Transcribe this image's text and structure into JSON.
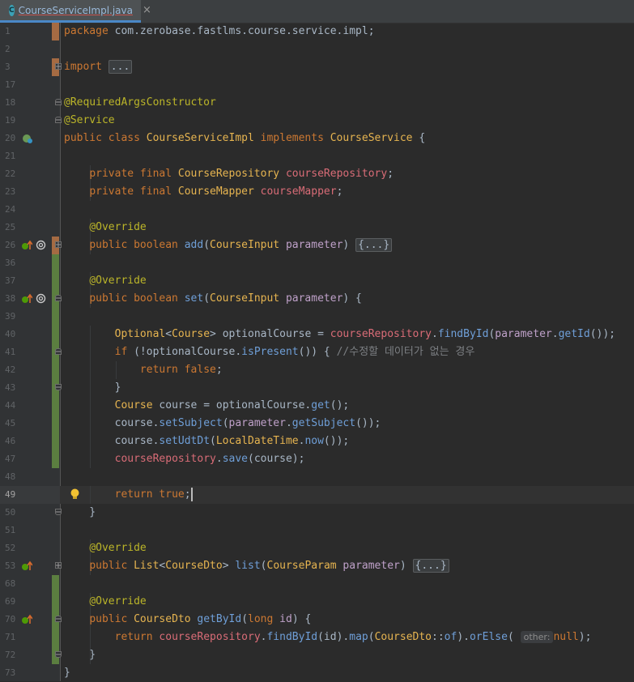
{
  "tab": {
    "filename": "CourseServiceImpl.java",
    "close_glyph": "×",
    "icon_letter": "C",
    "icon": "java-class-icon"
  },
  "lines": [
    {
      "n": "1",
      "vcs": "mod",
      "tokens": [
        [
          "kw",
          "package "
        ],
        [
          "plain",
          "com.zerobase.fastlms.course.service.impl;"
        ]
      ]
    },
    {
      "n": "2"
    },
    {
      "n": "3",
      "vcs": "mod",
      "fold": "plus",
      "tokens": [
        [
          "kw",
          "import "
        ],
        [
          "folded",
          "..."
        ]
      ]
    },
    {
      "n": "17"
    },
    {
      "n": "18",
      "fold": "start",
      "tokens": [
        [
          "ann",
          "@RequiredArgsConstructor"
        ]
      ]
    },
    {
      "n": "19",
      "fold": "start",
      "tokens": [
        [
          "ann",
          "@Service"
        ]
      ]
    },
    {
      "n": "20",
      "gicon": "bean",
      "tokens": [
        [
          "kw",
          "public class "
        ],
        [
          "cls",
          "CourseServiceImpl "
        ],
        [
          "kw",
          "implements "
        ],
        [
          "cls",
          "CourseService "
        ],
        [
          "plain",
          "{"
        ]
      ]
    },
    {
      "n": "21"
    },
    {
      "n": "22",
      "tokens": [
        [
          "plain",
          "    "
        ],
        [
          "kw",
          "private final "
        ],
        [
          "cls",
          "CourseRepository "
        ],
        [
          "fld",
          "courseRepository"
        ],
        [
          "plain",
          ";"
        ]
      ]
    },
    {
      "n": "23",
      "tokens": [
        [
          "plain",
          "    "
        ],
        [
          "kw",
          "private final "
        ],
        [
          "cls",
          "CourseMapper "
        ],
        [
          "fld",
          "courseMapper"
        ],
        [
          "plain",
          ";"
        ]
      ]
    },
    {
      "n": "24"
    },
    {
      "n": "25",
      "tokens": [
        [
          "plain",
          "    "
        ],
        [
          "ann",
          "@Override"
        ]
      ]
    },
    {
      "n": "26",
      "vcs": "mod",
      "gicon": "override",
      "fold": "plus",
      "tokens": [
        [
          "plain",
          "    "
        ],
        [
          "kw",
          "public boolean "
        ],
        [
          "mth",
          "add"
        ],
        [
          "plain",
          "("
        ],
        [
          "cls",
          "CourseInput "
        ],
        [
          "par",
          "parameter"
        ],
        [
          "plain",
          ") "
        ],
        [
          "folded",
          "{...}"
        ]
      ]
    },
    {
      "n": "36",
      "vcs": "add"
    },
    {
      "n": "37",
      "vcs": "add",
      "tokens": [
        [
          "plain",
          "    "
        ],
        [
          "ann",
          "@Override"
        ]
      ]
    },
    {
      "n": "38",
      "vcs": "add",
      "gicon": "override",
      "fold": "start",
      "tokens": [
        [
          "plain",
          "    "
        ],
        [
          "kw",
          "public boolean "
        ],
        [
          "mth",
          "set"
        ],
        [
          "plain",
          "("
        ],
        [
          "cls",
          "CourseInput "
        ],
        [
          "par",
          "parameter"
        ],
        [
          "plain",
          ") {"
        ]
      ]
    },
    {
      "n": "39",
      "vcs": "add"
    },
    {
      "n": "40",
      "vcs": "add",
      "tokens": [
        [
          "plain",
          "        "
        ],
        [
          "cls",
          "Optional"
        ],
        [
          "plain",
          "<"
        ],
        [
          "cls",
          "Course"
        ],
        [
          "plain",
          "> optionalCourse = "
        ],
        [
          "fld",
          "courseRepository"
        ],
        [
          "plain",
          "."
        ],
        [
          "mth",
          "findById"
        ],
        [
          "plain",
          "("
        ],
        [
          "par",
          "parameter"
        ],
        [
          "plain",
          "."
        ],
        [
          "mth",
          "getId"
        ],
        [
          "plain",
          "());"
        ]
      ]
    },
    {
      "n": "41",
      "vcs": "add",
      "fold": "start",
      "tokens": [
        [
          "plain",
          "        "
        ],
        [
          "kw",
          "if "
        ],
        [
          "plain",
          "(!optionalCourse."
        ],
        [
          "mth",
          "isPresent"
        ],
        [
          "plain",
          "()) { "
        ],
        [
          "cmt",
          "//수정할 데이터가 없는 경우"
        ]
      ]
    },
    {
      "n": "42",
      "vcs": "add",
      "tokens": [
        [
          "plain",
          "            "
        ],
        [
          "kw",
          "return false"
        ],
        [
          "plain",
          ";"
        ]
      ]
    },
    {
      "n": "43",
      "vcs": "add",
      "fold": "end",
      "tokens": [
        [
          "plain",
          "        }"
        ]
      ]
    },
    {
      "n": "44",
      "vcs": "add",
      "tokens": [
        [
          "plain",
          "        "
        ],
        [
          "cls",
          "Course "
        ],
        [
          "plain",
          "course = optionalCourse."
        ],
        [
          "mth",
          "get"
        ],
        [
          "plain",
          "();"
        ]
      ]
    },
    {
      "n": "45",
      "vcs": "add",
      "tokens": [
        [
          "plain",
          "        course."
        ],
        [
          "mth",
          "setSubject"
        ],
        [
          "plain",
          "("
        ],
        [
          "par",
          "parameter"
        ],
        [
          "plain",
          "."
        ],
        [
          "mth",
          "getSubject"
        ],
        [
          "plain",
          "());"
        ]
      ]
    },
    {
      "n": "46",
      "vcs": "add",
      "tokens": [
        [
          "plain",
          "        course."
        ],
        [
          "mth",
          "setUdtDt"
        ],
        [
          "plain",
          "("
        ],
        [
          "cls",
          "LocalDateTime"
        ],
        [
          "plain",
          "."
        ],
        [
          "mth",
          "now"
        ],
        [
          "plain",
          "());"
        ]
      ]
    },
    {
      "n": "47",
      "vcs": "add",
      "tokens": [
        [
          "plain",
          "        "
        ],
        [
          "fld",
          "courseRepository"
        ],
        [
          "plain",
          "."
        ],
        [
          "mth",
          "save"
        ],
        [
          "plain",
          "(course);"
        ]
      ]
    },
    {
      "n": "48"
    },
    {
      "n": "49",
      "current": true,
      "bulb": true,
      "tokens": [
        [
          "plain",
          "        "
        ],
        [
          "kw",
          "return true"
        ],
        [
          "plain",
          ";"
        ],
        [
          "caret",
          ""
        ]
      ]
    },
    {
      "n": "50",
      "fold": "end",
      "tokens": [
        [
          "plain",
          "    }"
        ]
      ]
    },
    {
      "n": "51"
    },
    {
      "n": "52",
      "tokens": [
        [
          "plain",
          "    "
        ],
        [
          "ann",
          "@Override"
        ]
      ]
    },
    {
      "n": "53",
      "gicon": "override-simple",
      "fold": "plus",
      "tokens": [
        [
          "plain",
          "    "
        ],
        [
          "kw",
          "public "
        ],
        [
          "cls",
          "List"
        ],
        [
          "plain",
          "<"
        ],
        [
          "cls",
          "CourseDto"
        ],
        [
          "plain",
          "> "
        ],
        [
          "mth",
          "list"
        ],
        [
          "plain",
          "("
        ],
        [
          "cls",
          "CourseParam "
        ],
        [
          "par",
          "parameter"
        ],
        [
          "plain",
          ") "
        ],
        [
          "folded",
          "{...}"
        ]
      ]
    },
    {
      "n": "68",
      "vcs": "add"
    },
    {
      "n": "69",
      "vcs": "add",
      "tokens": [
        [
          "plain",
          "    "
        ],
        [
          "ann",
          "@Override"
        ]
      ]
    },
    {
      "n": "70",
      "vcs": "add",
      "gicon": "override-simple",
      "fold": "start",
      "tokens": [
        [
          "plain",
          "    "
        ],
        [
          "kw",
          "public "
        ],
        [
          "cls",
          "CourseDto "
        ],
        [
          "mth",
          "getById"
        ],
        [
          "plain",
          "("
        ],
        [
          "kw",
          "long "
        ],
        [
          "par",
          "id"
        ],
        [
          "plain",
          ") {"
        ]
      ]
    },
    {
      "n": "71",
      "vcs": "add",
      "tokens": [
        [
          "plain",
          "        "
        ],
        [
          "kw",
          "return "
        ],
        [
          "fld",
          "courseRepository"
        ],
        [
          "plain",
          "."
        ],
        [
          "mth",
          "findById"
        ],
        [
          "plain",
          "(id)."
        ],
        [
          "mth",
          "map"
        ],
        [
          "plain",
          "("
        ],
        [
          "cls",
          "CourseDto"
        ],
        [
          "plain",
          "::"
        ],
        [
          "mth",
          "of"
        ],
        [
          "plain",
          ")."
        ],
        [
          "mth",
          "orElse"
        ],
        [
          "plain",
          "( "
        ],
        [
          "hint",
          "other:"
        ],
        [
          "kw",
          "null"
        ],
        [
          "plain",
          ");"
        ]
      ]
    },
    {
      "n": "72",
      "vcs": "add",
      "fold": "end",
      "tokens": [
        [
          "plain",
          "    }"
        ]
      ]
    },
    {
      "n": "73",
      "tokens": [
        [
          "plain",
          "}"
        ]
      ]
    }
  ]
}
